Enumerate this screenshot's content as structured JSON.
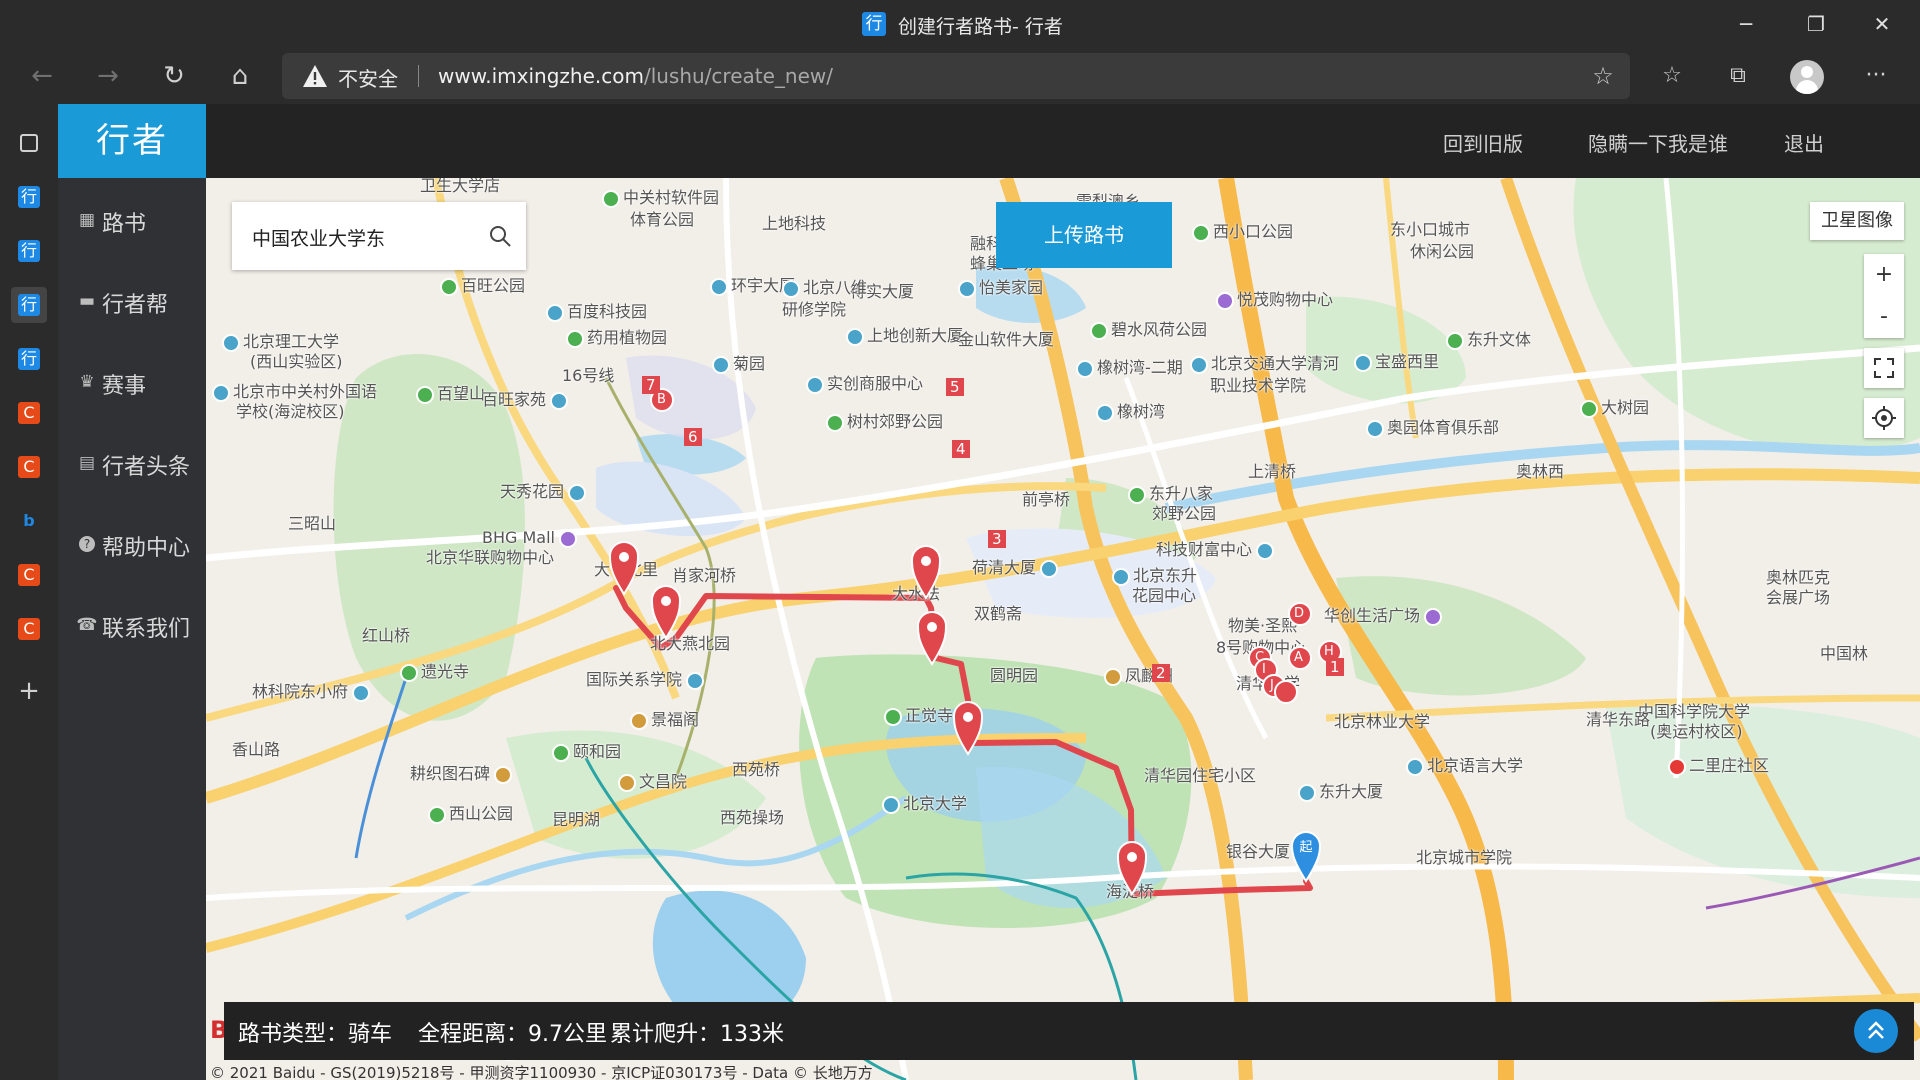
{
  "window": {
    "title": "创建行者路书- 行者",
    "tab_icon": "行",
    "minimize": "─",
    "restore": "❐",
    "close": "✕"
  },
  "toolbar": {
    "back": "←",
    "forward": "→",
    "reload": "↻",
    "home": "⌂",
    "insecure_label": "不安全",
    "url_host": "www.imxingzhe.com",
    "url_path": "/lushu/create_new/",
    "favorite": "☆",
    "favorites": "☆",
    "collections": "⧉",
    "more": "···"
  },
  "vertical_tabs": [
    {
      "icon": "▢",
      "color": "#2b2b2b",
      "kind": "tab-actions"
    },
    {
      "icon": "行",
      "color": "#1e88e5",
      "kind": "xingzhe"
    },
    {
      "icon": "行",
      "color": "#1e88e5",
      "kind": "xingzhe"
    },
    {
      "icon": "行",
      "color": "#1e88e5",
      "kind": "xingzhe-active"
    },
    {
      "icon": "行",
      "color": "#1e88e5",
      "kind": "xingzhe"
    },
    {
      "icon": "C",
      "color": "#e64a19",
      "kind": "csdn"
    },
    {
      "icon": "C",
      "color": "#e64a19",
      "kind": "csdn"
    },
    {
      "icon": "b",
      "color": "#1565c0",
      "kind": "bing"
    },
    {
      "icon": "C",
      "color": "#e64a19",
      "kind": "csdn"
    },
    {
      "icon": "C",
      "color": "#e64a19",
      "kind": "csdn"
    },
    {
      "icon": "+",
      "color": "#2b2b2b",
      "kind": "new-tab"
    }
  ],
  "app": {
    "logo": "行者",
    "menu": [
      {
        "label": "路书",
        "icon": "▦"
      },
      {
        "label": "行者帮",
        "icon": "▬"
      },
      {
        "label": "赛事",
        "icon": "♛"
      },
      {
        "label": "行者头条",
        "icon": "▤"
      },
      {
        "label": "帮助中心",
        "icon": "?"
      },
      {
        "label": "联系我们",
        "icon": "☎"
      }
    ],
    "header_links": [
      "回到旧版",
      "隐瞒一下我是谁",
      "退出"
    ]
  },
  "map": {
    "search_value": "中国农业大学东",
    "upload_button": "上传路书",
    "satellite_button": "卫星图像",
    "zoom_in": "+",
    "zoom_out": "-",
    "route_color": "#e0474c",
    "waypoint_labels": [
      "1",
      "2",
      "3",
      "4",
      "5",
      "6",
      "7"
    ],
    "start_label": "起",
    "letter_markers": [
      "A",
      "B",
      "C",
      "D",
      "H",
      "I",
      "J"
    ],
    "pois": [
      "卫生大学店",
      "中关村软件园",
      "体育公园",
      "上地科技",
      "雪梨澳乡",
      "西小口公园",
      "东小口城市",
      "休闲公园",
      "百旺公园",
      "百度科技园",
      "环宇大厦",
      "得实大厦",
      "融科融智",
      "蜂巢工场",
      "悦茂购物中心",
      "东升文体",
      "北京理工大学",
      "(西山实验区)",
      "北京八维",
      "研修学院",
      "上地创新大厦",
      "怡美家园",
      "碧水风荷公园",
      "宝盛西里",
      "药用植物园",
      "金山软件大厦",
      "16号线",
      "菊园",
      "实创商服中心",
      "橡树湾-二期",
      "北京交通大学清河",
      "职业技术学院",
      "北京市中关村外国语",
      "学校(海淀校区)",
      "百望山",
      "百旺家苑",
      "树村郊野公园",
      "橡树湾",
      "奥园体育俱乐部",
      "大树园",
      "上清桥",
      "奥林西",
      "天秀花园",
      "三昭山",
      "前亭桥",
      "东升八家",
      "郊野公园",
      "BHG Mall",
      "北京华联购物中心",
      "大有北里",
      "肖家河桥",
      "科技财富中心",
      "荷清大厦",
      "大水法",
      "北京东升",
      "花园中心",
      "奥林匹克",
      "会展广场",
      "双鹤斋",
      "物美·圣熙",
      "8号购物中心",
      "华创生活广场",
      "红山桥",
      "北大燕北园",
      "圆明园",
      "遗光寺",
      "国际关系学院",
      "凤麟洲",
      "清华大学",
      "中国科学院大学",
      "(奥运村校区)",
      "林科院东小府",
      "中国林",
      "正觉寺",
      "景福阁",
      "北京林业大学",
      "清华东路",
      "香山路",
      "颐和园",
      "文昌院",
      "耕织图石碑",
      "西苑桥",
      "清华园住宅小区",
      "北京语言大学",
      "二里庄社区",
      "西山公园",
      "昆明湖",
      "北京大学",
      "东升大厦",
      "西苑操场",
      "银谷大厦",
      "北京城市学院",
      "海淀桥"
    ],
    "info": {
      "type": "路书类型：骑车",
      "distance": "全程距离：9.7公里",
      "climb": "累计爬升：133米"
    },
    "copyright": "© 2021 Baidu - GS(2019)5218号 - 甲测资字1100930 - 京ICP证030173号 - Data © 长地万方",
    "baidu_mark": "B"
  }
}
